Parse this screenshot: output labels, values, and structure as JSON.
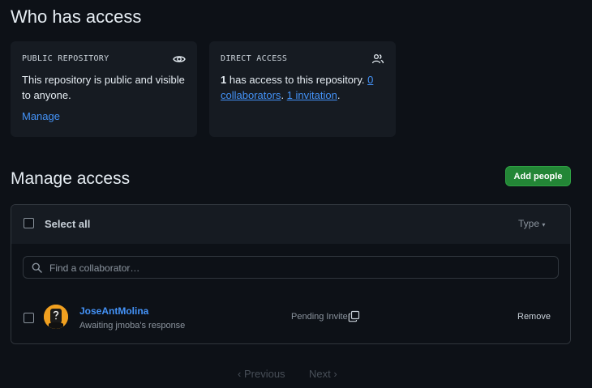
{
  "who_has_access": {
    "title": "Who has access",
    "public_card": {
      "title": "PUBLIC REPOSITORY",
      "icon": "eye-icon",
      "body": "This repository is public and visible to anyone.",
      "link": "Manage"
    },
    "direct_card": {
      "title": "DIRECT ACCESS",
      "icon": "people-icon",
      "count": "1",
      "text": " has access to this repository. ",
      "collaborators_link": "0 collaborators",
      "separator": ". ",
      "invitations_link": "1 invitation",
      "end": "."
    }
  },
  "manage_access": {
    "title": "Manage access",
    "add_button": "Add people",
    "select_all": "Select all",
    "type_filter": "Type",
    "search_placeholder": "Find a collaborator…",
    "rows": [
      {
        "name": "JoseAntMolina",
        "status": "Awaiting jmoba's response",
        "state": "Pending Invite",
        "action": "Remove"
      }
    ]
  },
  "pagination": {
    "previous": "Previous",
    "next": "Next"
  },
  "colors": {
    "background": "#0d1117",
    "card": "#161b22",
    "link": "#4493f8",
    "primary_button": "#238636",
    "avatar": "#f0a020"
  }
}
